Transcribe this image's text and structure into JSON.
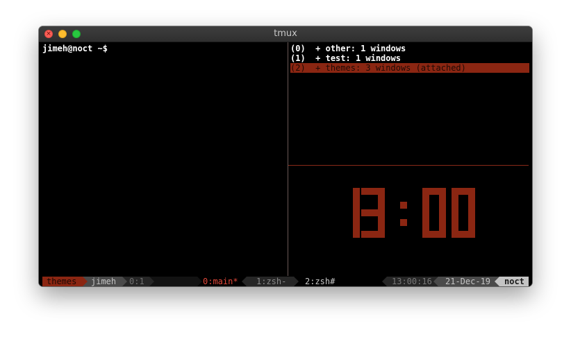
{
  "window": {
    "title": "tmux"
  },
  "terminal": {
    "prompt": "jimeh@noct ~$",
    "sessions": [
      {
        "index": "(0)",
        "text": "+ other: 1 windows",
        "selected": false
      },
      {
        "index": "(1)",
        "text": "+ test: 1 windows",
        "selected": false
      },
      {
        "index": "(2)",
        "text": "+ themes: 3 windows (attached)",
        "selected": true
      }
    ],
    "clock": "13:00"
  },
  "statusbar": {
    "session": "themes",
    "user": "jimeh",
    "pane": "0:1",
    "windows": [
      {
        "label": "0:main*",
        "active": true
      },
      {
        "label": "1:zsh-",
        "active": false
      },
      {
        "label": "2:zsh#",
        "active": false
      }
    ],
    "time": "13:00:16",
    "date": "21-Dec-19",
    "host": "noct"
  },
  "colors": {
    "accent": "#8b2612",
    "clock": "#8b2612",
    "terminal_bg": "#000000",
    "status_active": "#e0483a"
  },
  "icons": {
    "close": "close-icon",
    "minimize": "minimize-icon",
    "maximize": "maximize-icon"
  }
}
